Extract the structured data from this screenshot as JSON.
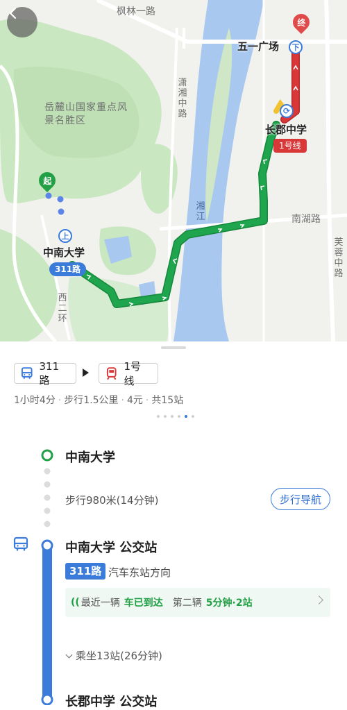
{
  "map": {
    "place_labels": {
      "fenglin_road": "枫林一路",
      "yuelu_park": "岳麓山国家重点风景名胜区",
      "xiangjiang_middle_road": "潇湘中路",
      "xiangjiang": "湘江",
      "nanhu_road": "南湖路",
      "furong_middle_road": "芙蓉中路",
      "west_second_ring": "西二环"
    },
    "markers": {
      "start": "起",
      "end": "终",
      "board": "上",
      "alight": "下"
    },
    "stations": {
      "origin": "中南大学",
      "transfer": "长郡中学",
      "destination": "五一广场"
    },
    "route_badges": {
      "bus": "311路",
      "metro": "1号线"
    },
    "colors": {
      "bus_route": "#1ea54d",
      "metro_route": "#d93838",
      "water": "#a9c8f0",
      "park": "#c9e7c0",
      "accent": "#3b7bd9"
    }
  },
  "summary": {
    "bus_chip": {
      "icon": "bus-icon",
      "label": "311路"
    },
    "metro_chip": {
      "icon": "metro-icon",
      "label": "1号线"
    },
    "meta": {
      "duration": "1小时4分",
      "walk": "步行1.5公里",
      "price": "4元",
      "stops": "共15站"
    },
    "page_indicator": {
      "total": 6,
      "active": 5
    }
  },
  "timeline": {
    "origin": "中南大学",
    "walk_text": "步行980米(14分钟)",
    "walk_nav_button": "步行导航",
    "bus_stop": "中南大学 公交站",
    "bus_line": "311路",
    "bus_direction": "汽车东站方向",
    "arrival": {
      "first_label": "最近一辆",
      "first_status": "车已到达",
      "second_label": "第二辆",
      "second_status": "5分钟·2站"
    },
    "ride_info": "乘坐13站(26分钟)",
    "next_stop": "长郡中学 公交站"
  }
}
